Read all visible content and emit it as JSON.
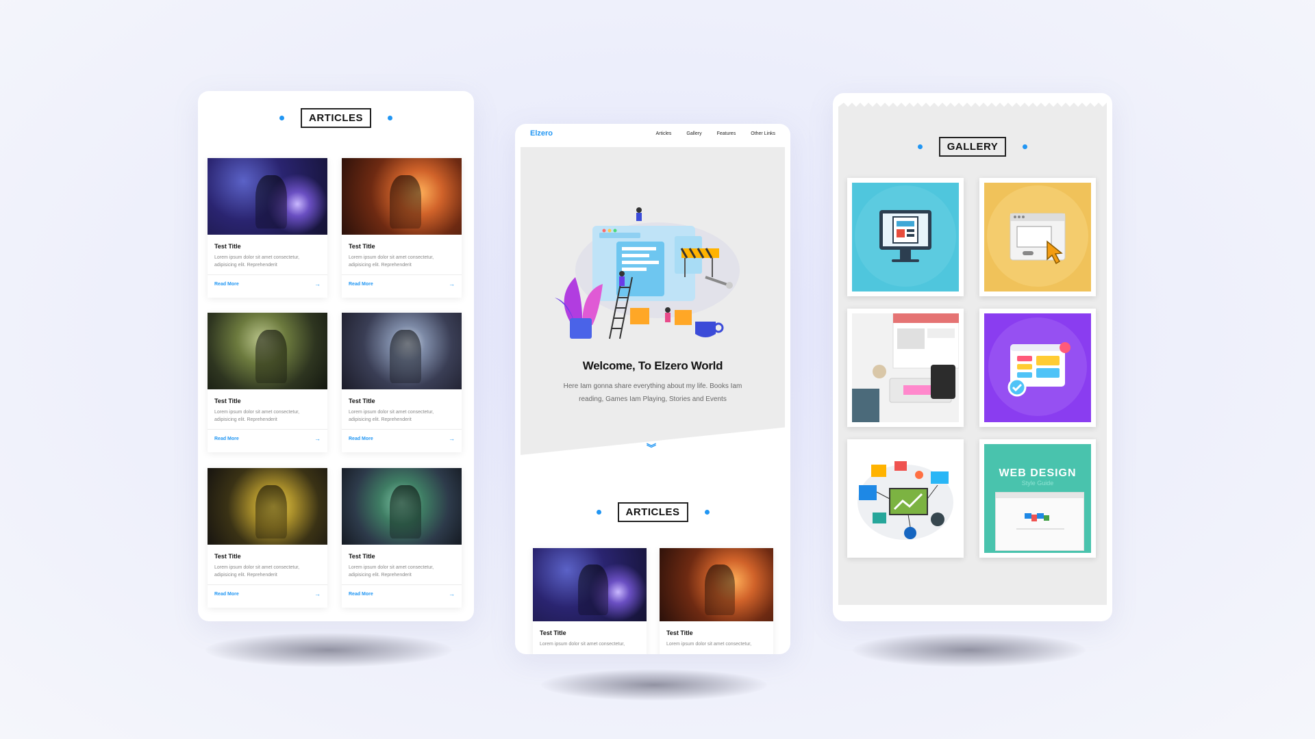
{
  "colors": {
    "accent": "#2196f3",
    "background": "#eceefb",
    "hero_bg": "#ececec"
  },
  "left_panel": {
    "heading": "ARTICLES",
    "cards": [
      {
        "title": "Test Title",
        "text": "Lorem ipsum dolor sit amet consectetur, adipisicing elit. Reprehenderit",
        "link": "Read More",
        "image": "game-art-purple-warrior"
      },
      {
        "title": "Test Title",
        "text": "Lorem ipsum dolor sit amet consectetur, adipisicing elit. Reprehenderit",
        "link": "Read More",
        "image": "game-art-bear-character"
      },
      {
        "title": "Test Title",
        "text": "Lorem ipsum dolor sit amet consectetur, adipisicing elit. Reprehenderit",
        "link": "Read More",
        "image": "game-art-soldier-woman"
      },
      {
        "title": "Test Title",
        "text": "Lorem ipsum dolor sit amet consectetur, adipisicing elit. Reprehenderit",
        "link": "Read More",
        "image": "game-art-winged-warrior"
      },
      {
        "title": "Test Title",
        "text": "Lorem ipsum dolor sit amet consectetur, adipisicing elit. Reprehenderit",
        "link": "Read More",
        "image": "game-art-dark-knight"
      },
      {
        "title": "Test Title",
        "text": "Lorem ipsum dolor sit amet consectetur, adipisicing elit. Reprehenderit",
        "link": "Read More",
        "image": "game-art-green-mech"
      }
    ]
  },
  "middle_panel": {
    "logo": "Elzero",
    "nav": [
      "Articles",
      "Gallery",
      "Features",
      "Other Links"
    ],
    "hero": {
      "title": "Welcome, To Elzero World",
      "text": "Here Iam gonna share everything about my life. Books Iam reading, Games Iam Playing, Stories and Events"
    },
    "heading": "ARTICLES",
    "cards": [
      {
        "title": "Test Title",
        "text": "Lorem ipsum dolor sit amet consectetur,"
      },
      {
        "title": "Test Title",
        "text": "Lorem ipsum dolor sit amet consectetur,"
      }
    ]
  },
  "right_panel": {
    "heading": "GALLERY",
    "items": [
      {
        "image": "computer-monitor-illustration"
      },
      {
        "image": "browser-cursor-illustration"
      },
      {
        "image": "designer-desk-photo"
      },
      {
        "image": "web-app-ui-illustration"
      },
      {
        "image": "network-icons-illustration"
      },
      {
        "image": "web-design-style-guide",
        "title": "WEB DESIGN",
        "subtitle": "Style Guide"
      }
    ]
  }
}
